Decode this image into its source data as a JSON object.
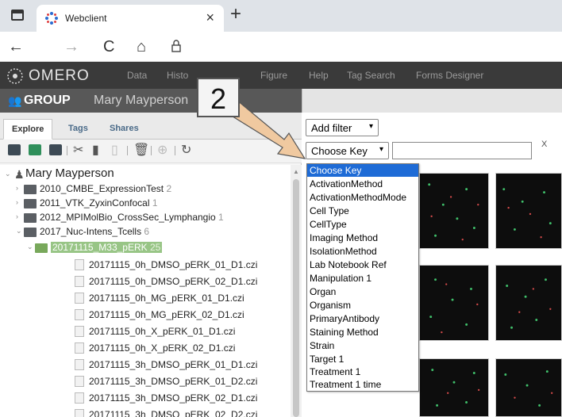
{
  "browser": {
    "tab_title": "Webclient",
    "tab_close": "×",
    "new_tab": "+",
    "nav_back": "←",
    "nav_forward": "→",
    "nav_reload": "C",
    "nav_home": "⌂",
    "lock": "🔒"
  },
  "omero": {
    "logo": "OMERO",
    "nav": [
      "Data",
      "Histo",
      "Figure",
      "Help",
      "Tag Search",
      "Forms Designer"
    ]
  },
  "group": {
    "label": "GROUP",
    "user": "Mary Mayperson"
  },
  "panel_tabs": [
    "Explore",
    "Tags",
    "Shares"
  ],
  "tree": {
    "user": "Mary Mayperson",
    "projects": [
      {
        "name": "2010_CMBE_ExpressionTest",
        "count": "2"
      },
      {
        "name": "2011_VTK_ZyxinConfocal",
        "count": "1"
      },
      {
        "name": "2012_MPIMolBio_CrossSec_Lymphangio",
        "count": "1"
      },
      {
        "name": "2017_Nuc-Intens_Tcells",
        "count": "6"
      }
    ],
    "dataset": {
      "name": "20171115_M33_pERK",
      "count": "25"
    },
    "images": [
      "20171115_0h_DMSO_pERK_01_D1.czi",
      "20171115_0h_DMSO_pERK_02_D1.czi",
      "20171115_0h_MG_pERK_01_D1.czi",
      "20171115_0h_MG_pERK_02_D1.czi",
      "20171115_0h_X_pERK_01_D1.czi",
      "20171115_0h_X_pERK_02_D1.czi",
      "20171115_3h_DMSO_pERK_01_D1.czi",
      "20171115_3h_DMSO_pERK_01_D2.czi",
      "20171115_3h_DMSO_pERK_02_D1.czi",
      "20171115_3h_DMSO_pERK_02_D2.czi"
    ]
  },
  "filter": {
    "add_filter": "Add filter",
    "choose_key": "Choose Key",
    "clear": "X",
    "options": [
      "Choose Key",
      "ActivationMethod",
      "ActivationMethodMode",
      "Cell Type",
      "CellType",
      "Imaging Method",
      "IsolationMethod",
      "Lab Notebook Ref",
      "Manipulation 1",
      "Organ",
      "Organism",
      "PrimaryAntibody",
      "Staining Method",
      "Strain",
      "Target 1",
      "Treatment 1",
      "Treatment 1 time"
    ]
  },
  "annotation": {
    "number": "2"
  },
  "colors": {
    "omero_nav": "#3a3a3a",
    "group_bar": "#585858",
    "selected_dataset": "#98c586",
    "dropdown_highlight": "#1e6bd6",
    "arrow_fill": "#f0c9a0"
  }
}
